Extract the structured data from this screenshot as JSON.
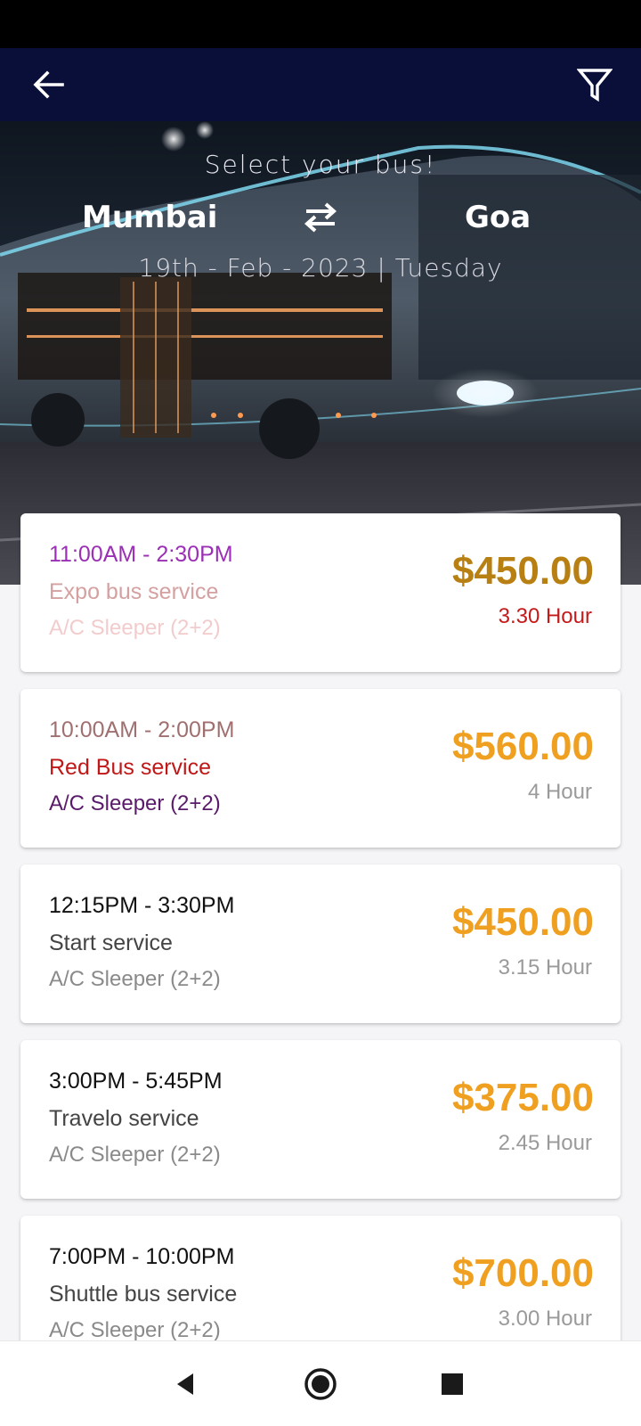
{
  "header": {
    "title": "Select your bus!",
    "from_city": "Mumbai",
    "to_city": "Goa",
    "date": "19th - Feb - 2023 | Tuesday"
  },
  "colors": {
    "app_bar": "#0a0f3a",
    "price_accent": "#f0a020"
  },
  "icons": {
    "back": "arrow-left-icon",
    "filter": "filter-icon",
    "swap": "swap-arrows-icon"
  },
  "buses": [
    {
      "time": "11:00AM - 2:30PM",
      "name": "Expo bus service",
      "type": "A/C Sleeper (2+2)",
      "price": "$450.00",
      "duration": "3.30 Hour",
      "colors": {
        "time": "#9b2fb5",
        "name": "#d4a0a0",
        "type": "#f2cccc",
        "price": "#b88012",
        "duration": "#c41a1a"
      }
    },
    {
      "time": "10:00AM - 2:00PM",
      "name": "Red Bus service",
      "type": "A/C Sleeper (2+2)",
      "price": "$560.00",
      "duration": "4 Hour",
      "colors": {
        "time": "#a07070",
        "name": "#c01818",
        "type": "#5a1a6a",
        "price": "#f0a020",
        "duration": "#9a9a9a"
      }
    },
    {
      "time": "12:15PM - 3:30PM",
      "name": "Start service",
      "type": "A/C Sleeper (2+2)",
      "price": "$450.00",
      "duration": "3.15 Hour",
      "colors": {
        "time": "#111111",
        "name": "#444444",
        "type": "#8a8a8a",
        "price": "#f0a020",
        "duration": "#9a9a9a"
      }
    },
    {
      "time": "3:00PM - 5:45PM",
      "name": "Travelo service",
      "type": "A/C Sleeper (2+2)",
      "price": "$375.00",
      "duration": "2.45 Hour",
      "colors": {
        "time": "#111111",
        "name": "#444444",
        "type": "#8a8a8a",
        "price": "#f0a020",
        "duration": "#9a9a9a"
      }
    },
    {
      "time": "7:00PM - 10:00PM",
      "name": "Shuttle bus service",
      "type": "A/C Sleeper (2+2)",
      "price": "$700.00",
      "duration": "3.00 Hour",
      "colors": {
        "time": "#111111",
        "name": "#444444",
        "type": "#8a8a8a",
        "price": "#f0a020",
        "duration": "#9a9a9a"
      }
    }
  ],
  "nav": {
    "back": "nav-back-icon",
    "home": "nav-home-icon",
    "recents": "nav-recents-icon"
  }
}
